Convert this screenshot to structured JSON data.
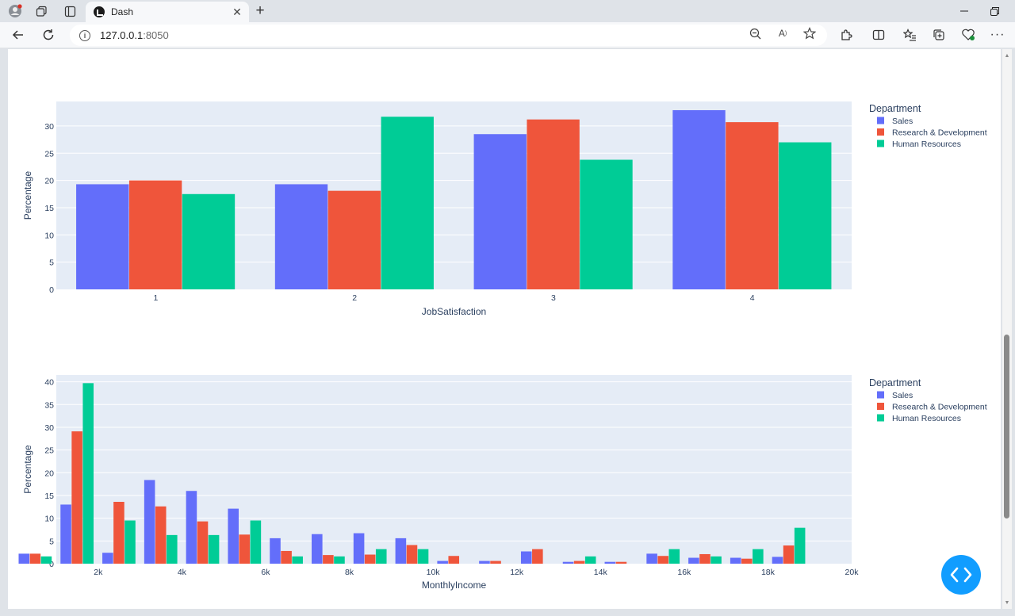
{
  "browser": {
    "tab_title": "Dash",
    "tab_close": "✕",
    "new_tab": "+",
    "url_host": "127.0.0.1",
    "url_port": ":8050"
  },
  "colors": {
    "sales": "#636efa",
    "rnd": "#ef553b",
    "hr": "#00cc96",
    "plot_bg": "#e5ecf6",
    "text": "#2a3f5f",
    "fab": "#119dff"
  },
  "chart_data": [
    {
      "type": "bar",
      "xlabel": "JobSatisfaction",
      "ylabel": "Percentage",
      "categories": [
        "1",
        "2",
        "3",
        "4"
      ],
      "ylim": [
        0,
        34.5
      ],
      "yticks": [
        0,
        5,
        10,
        15,
        20,
        25,
        30
      ],
      "grid": true,
      "legend_title": "Department",
      "legend_position": "top-right",
      "series": [
        {
          "name": "Sales",
          "values": [
            19.3,
            19.3,
            28.5,
            32.9
          ]
        },
        {
          "name": "Research & Development",
          "values": [
            20.0,
            18.1,
            31.2,
            30.7
          ]
        },
        {
          "name": "Human Resources",
          "values": [
            17.5,
            31.7,
            23.8,
            27.0
          ]
        }
      ]
    },
    {
      "type": "bar",
      "xlabel": "MonthlyIncome",
      "ylabel": "Percentage",
      "x": [
        1000,
        3000,
        5000,
        7000,
        9000,
        11000,
        13000,
        15000,
        17000,
        19000
      ],
      "offsets": [
        -500,
        500
      ],
      "xlim": [
        1000,
        20000
      ],
      "ylim": [
        0,
        41.5
      ],
      "xticks": [
        2000,
        4000,
        6000,
        8000,
        10000,
        12000,
        14000,
        16000,
        18000,
        20000
      ],
      "xtick_labels": [
        "2k",
        "4k",
        "6k",
        "8k",
        "10k",
        "12k",
        "14k",
        "16k",
        "18k",
        "20k"
      ],
      "yticks": [
        0,
        5,
        10,
        15,
        20,
        25,
        30,
        35,
        40
      ],
      "bin_width": 1000,
      "grid": true,
      "legend_title": "Department",
      "legend_position": "top-right",
      "series": [
        {
          "name": "Sales",
          "values": [
            2.2,
            13.0,
            2.4,
            18.4,
            16.0,
            12.1,
            5.6,
            6.5,
            6.7,
            5.6,
            0.6,
            0.6,
            2.7,
            0.4,
            0.4,
            2.2,
            1.3,
            1.3,
            1.5,
            null
          ]
        },
        {
          "name": "Research & Development",
          "values": [
            2.2,
            29.1,
            13.6,
            12.6,
            9.3,
            6.4,
            2.8,
            1.9,
            2.0,
            4.1,
            1.7,
            0.6,
            3.2,
            0.6,
            0.4,
            1.7,
            2.1,
            1.1,
            4.0,
            null
          ]
        },
        {
          "name": "Human Resources",
          "values": [
            1.6,
            39.7,
            9.5,
            6.3,
            6.3,
            9.5,
            1.6,
            1.6,
            3.2,
            3.2,
            0,
            0,
            0,
            1.6,
            0,
            3.2,
            1.6,
            3.2,
            7.9,
            null
          ]
        }
      ]
    }
  ]
}
